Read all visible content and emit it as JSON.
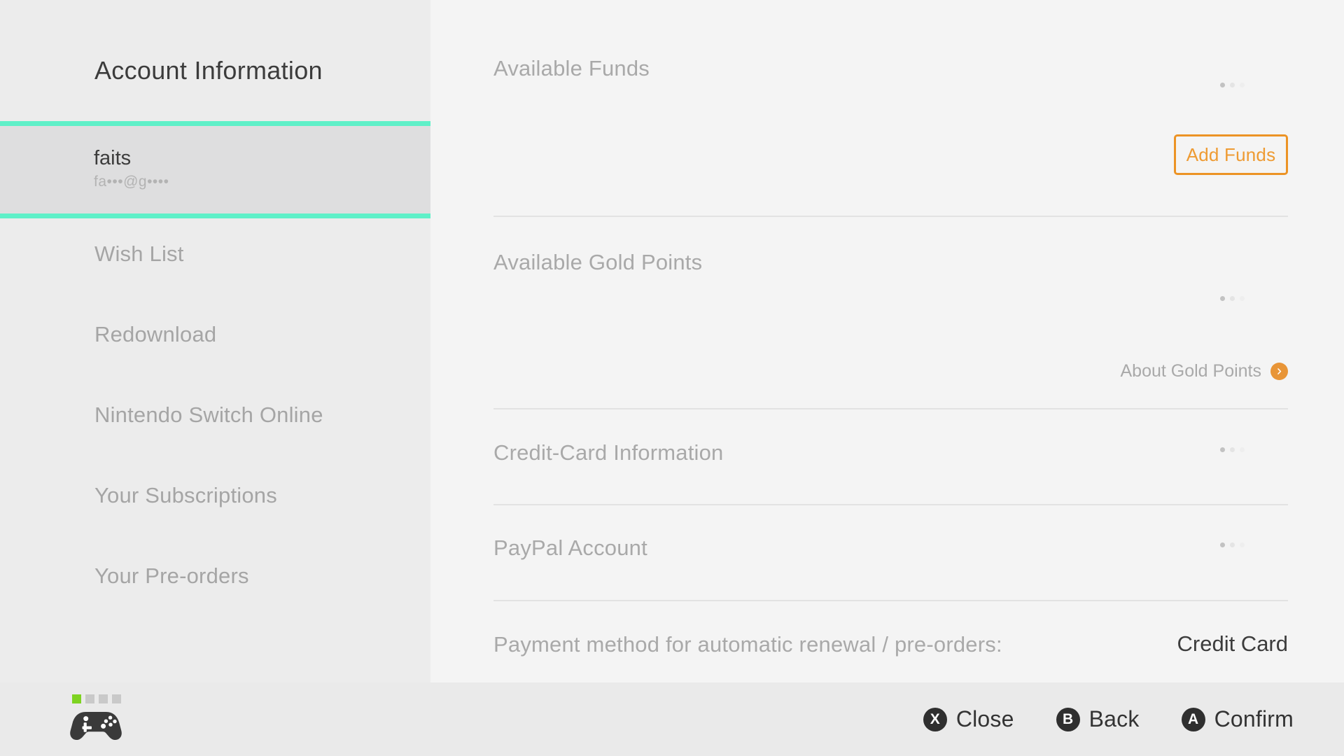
{
  "sidebar": {
    "title": "Account Information",
    "account": {
      "name": "faits",
      "email_masked": "fa•••@g••••"
    },
    "items": [
      {
        "label": "Wish List"
      },
      {
        "label": "Redownload"
      },
      {
        "label": "Nintendo Switch Online"
      },
      {
        "label": "Your Subscriptions"
      },
      {
        "label": "Your Pre-orders"
      }
    ]
  },
  "main": {
    "available_funds": {
      "label": "Available Funds",
      "value": "",
      "add_funds_label": "Add Funds"
    },
    "gold_points": {
      "label": "Available Gold Points",
      "value": "",
      "about_label": "About Gold Points",
      "about_icon": "chevron-right-icon"
    },
    "credit_card": {
      "label": "Credit-Card Information",
      "value": ""
    },
    "paypal": {
      "label": "PayPal Account",
      "value": ""
    },
    "payment_method": {
      "label": "Payment method for automatic renewal / pre-orders:",
      "value": "Credit Card"
    }
  },
  "bottom_bar": {
    "player_slots": [
      true,
      false,
      false,
      false
    ],
    "controller_icon": "gamepad-icon",
    "hints": [
      {
        "key": "X",
        "label": "Close"
      },
      {
        "key": "B",
        "label": "Back"
      },
      {
        "key": "A",
        "label": "Confirm"
      }
    ]
  },
  "colors": {
    "accent_orange": "#ec9325",
    "selection_teal": "#5ff0c8",
    "sidebar_bg": "#ececec",
    "content_bg": "#f4f4f4",
    "bottom_bar_bg": "#eaeaea",
    "player_active_green": "#7ed321"
  }
}
